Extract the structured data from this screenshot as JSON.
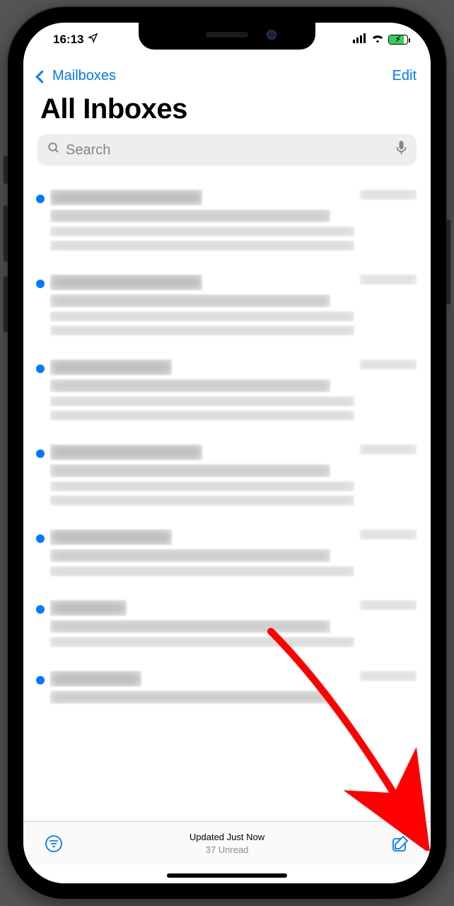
{
  "status": {
    "time": "16:13"
  },
  "nav": {
    "back_label": "Mailboxes",
    "edit_label": "Edit"
  },
  "title": "All Inboxes",
  "search": {
    "placeholder": "Search"
  },
  "toolbar": {
    "updated_label": "Updated Just Now",
    "unread_label": "37 Unread"
  },
  "colors": {
    "accent": "#007aff",
    "green": "#30d158",
    "annotation": "#ff0000"
  },
  "messages": [
    {
      "unread": true
    },
    {
      "unread": true
    },
    {
      "unread": true
    },
    {
      "unread": true
    },
    {
      "unread": true
    },
    {
      "unread": true
    },
    {
      "unread": true
    }
  ]
}
